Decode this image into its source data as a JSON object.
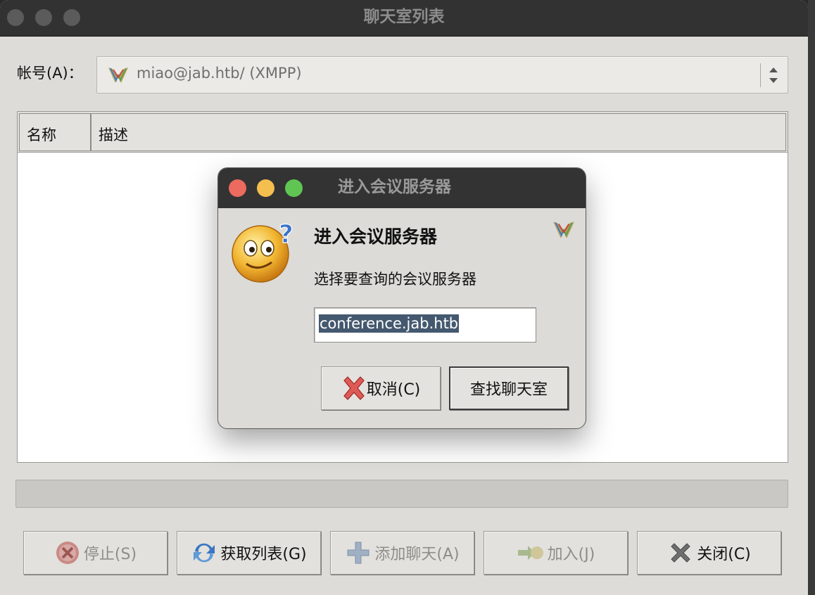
{
  "window": {
    "title": "聊天室列表"
  },
  "account": {
    "label": "帐号(A)：",
    "value": "miao@jab.htb/ (XMPP)"
  },
  "list": {
    "columns": [
      "名称",
      "描述"
    ]
  },
  "buttons": {
    "stop": "停止(S)",
    "get_list": "获取列表(G)",
    "add_chat": "添加聊天(A)",
    "join": "加入(J)",
    "close": "关闭(C)"
  },
  "dialog": {
    "title": "进入会议服务器",
    "heading": "进入会议服务器",
    "prompt": "选择要查询的会议服务器",
    "server_value": "conference.jab.htb",
    "cancel": "取消(C)",
    "find": "查找聊天室"
  },
  "colors": {
    "close_dot": "#ec6a5e",
    "minimize_dot": "#f4bf4f",
    "zoom_dot": "#61c554",
    "selection": "#44596f"
  }
}
